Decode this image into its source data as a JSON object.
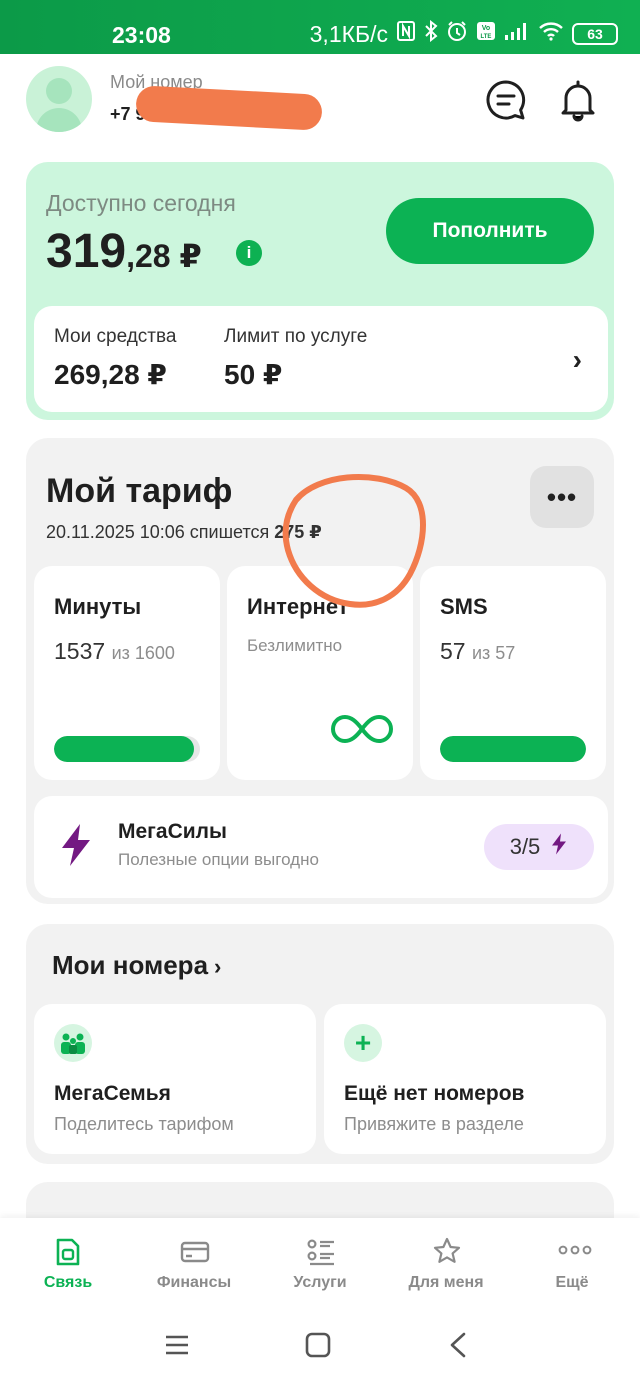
{
  "status_bar": {
    "time": "23:08",
    "network_speed": "3,1КБ/с",
    "battery": "63",
    "icons": [
      "nfc-icon",
      "bluetooth-icon",
      "alarm-icon",
      "volte-icon",
      "signal-icon",
      "wifi-icon",
      "battery-icon"
    ]
  },
  "header": {
    "number_label": "Мой номер",
    "number_value": "+7 9",
    "icons": [
      "avatar",
      "chat-icon",
      "bell-icon"
    ]
  },
  "balance": {
    "label": "Доступно сегодня",
    "amount_int": "319",
    "amount_frac": ",28 ₽",
    "info_glyph": "i",
    "topup_label": "Пополнить",
    "funds_label": "Мои средства",
    "funds_value": "269,28 ₽",
    "limit_label": "Лимит по услуге",
    "limit_value": "50 ₽",
    "chevron": "›"
  },
  "tariff": {
    "title": "Мой тариф",
    "date_text": "20.11.2025 10:06 спишется",
    "charge": "275 ₽",
    "more_glyph": "•••",
    "packages": [
      {
        "name": "Минуты",
        "used": "1537",
        "of": "из 1600",
        "level": 0.96
      },
      {
        "name": "Интернет",
        "sub": "Безлимитно"
      },
      {
        "name": "SMS",
        "used": "57",
        "of": "из 57",
        "level": 1.0
      }
    ],
    "megasily": {
      "title": "МегаСилы",
      "subtitle": "Полезные опции выгодно",
      "badge": "3/5"
    }
  },
  "numbers": {
    "title": "Мои номера",
    "chevron": "›",
    "cards": [
      {
        "title": "МегаСемья",
        "subtitle": "Поделитесь тарифом"
      },
      {
        "icon_glyph": "+",
        "title": "Ещё нет номеров",
        "subtitle": "Привяжите в разделе"
      }
    ]
  },
  "tabs": [
    {
      "label": "Связь",
      "icon": "sim-icon",
      "active": true
    },
    {
      "label": "Финансы",
      "icon": "wallet-icon"
    },
    {
      "label": "Услуги",
      "icon": "services-icon"
    },
    {
      "label": "Для меня",
      "icon": "star-icon"
    },
    {
      "label": "Ещё",
      "icon": "more-dots-icon"
    }
  ],
  "nav": [
    "recent-apps-icon",
    "home-icon",
    "back-icon"
  ],
  "colors": {
    "brand": "#0cb254",
    "balance_bg": "#ccf6dd",
    "card_bg": "#f2f2f2",
    "mega_badge": "#efe1fb",
    "mega_bolt": "#731982",
    "annotation": "#f27b4c"
  }
}
